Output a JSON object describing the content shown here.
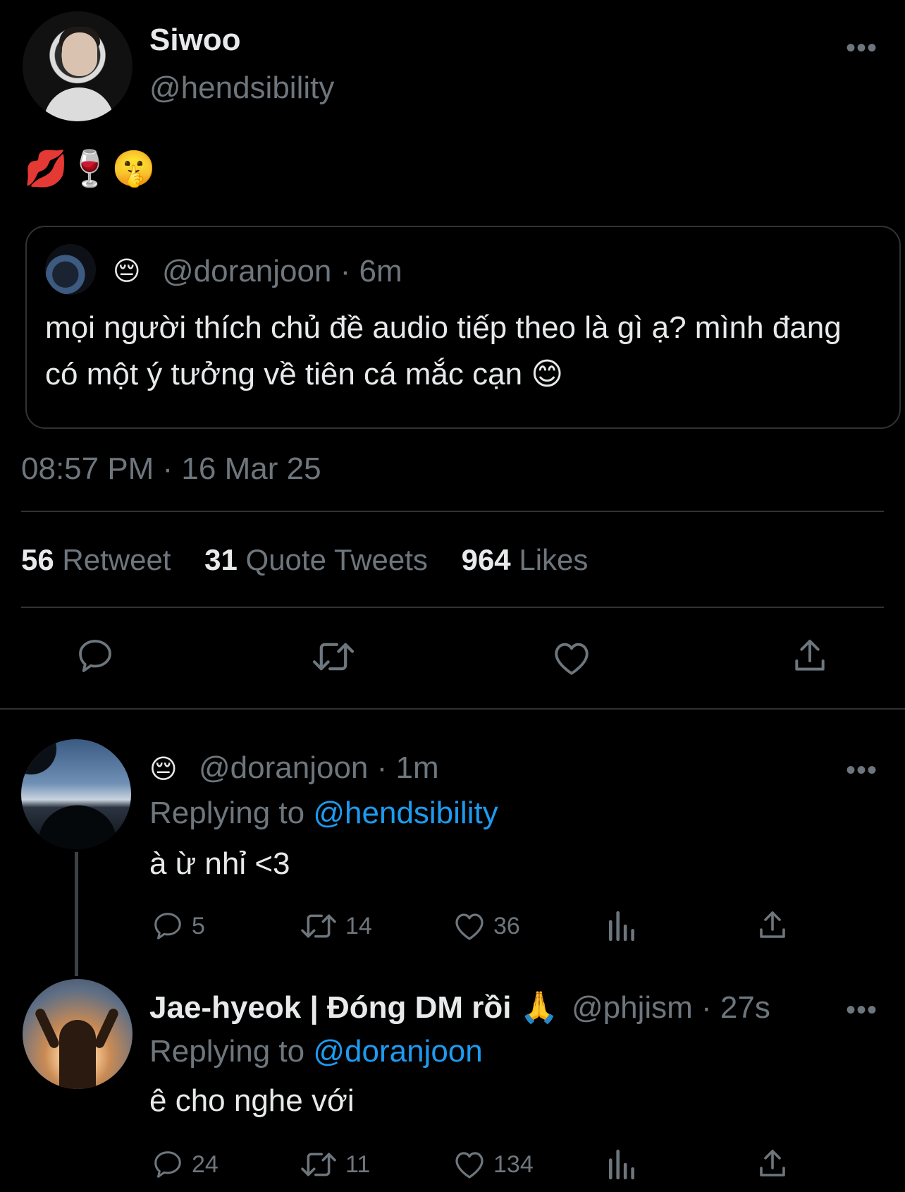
{
  "tweet": {
    "author_name": "Siwoo",
    "author_handle": "@hendsibility",
    "more_label": "•••",
    "emojis": "💋🍷🤫",
    "quote": {
      "emoji": "😔",
      "handle": "@doranjoon",
      "separator": " · ",
      "time": "6m",
      "text": "mọi người thích chủ đề audio tiếp theo là gì ạ? mình đang có một ý tưởng về tiên cá mắc cạn 😊"
    },
    "timestamp": "08:57 PM · 16 Mar 25",
    "stats": {
      "retweets_count": "56",
      "retweets_label": "Retweet",
      "quotes_count": "31",
      "quotes_label": "Quote Tweets",
      "likes_count": "964",
      "likes_label": "Likes"
    },
    "actions": [
      "reply-icon",
      "retweet-icon",
      "like-icon",
      "share-icon"
    ]
  },
  "replies": [
    {
      "emoji": "😔",
      "handle": "@doranjoon",
      "separator": " · ",
      "time": "1m",
      "replying_label": "Replying to ",
      "replying_to": "@hendsibility",
      "text": "à ừ nhỉ <3",
      "reply_count": "5",
      "retweet_count": "14",
      "like_count": "36",
      "more_label": "•••"
    },
    {
      "name": "Jae-hyeok | Đóng DM rồi 🙏",
      "handle": "@phjism",
      "separator": " · ",
      "time": "27s",
      "replying_label": "Replying to ",
      "replying_to": "@doranjoon",
      "text": "ê cho nghe với",
      "reply_count": "24",
      "retweet_count": "11",
      "like_count": "134",
      "more_label": "•••"
    }
  ],
  "colors": {
    "background": "#000000",
    "text": "#e7e9ea",
    "secondary": "#6e767d",
    "link": "#1d9bf0",
    "divider": "#2f3336"
  }
}
